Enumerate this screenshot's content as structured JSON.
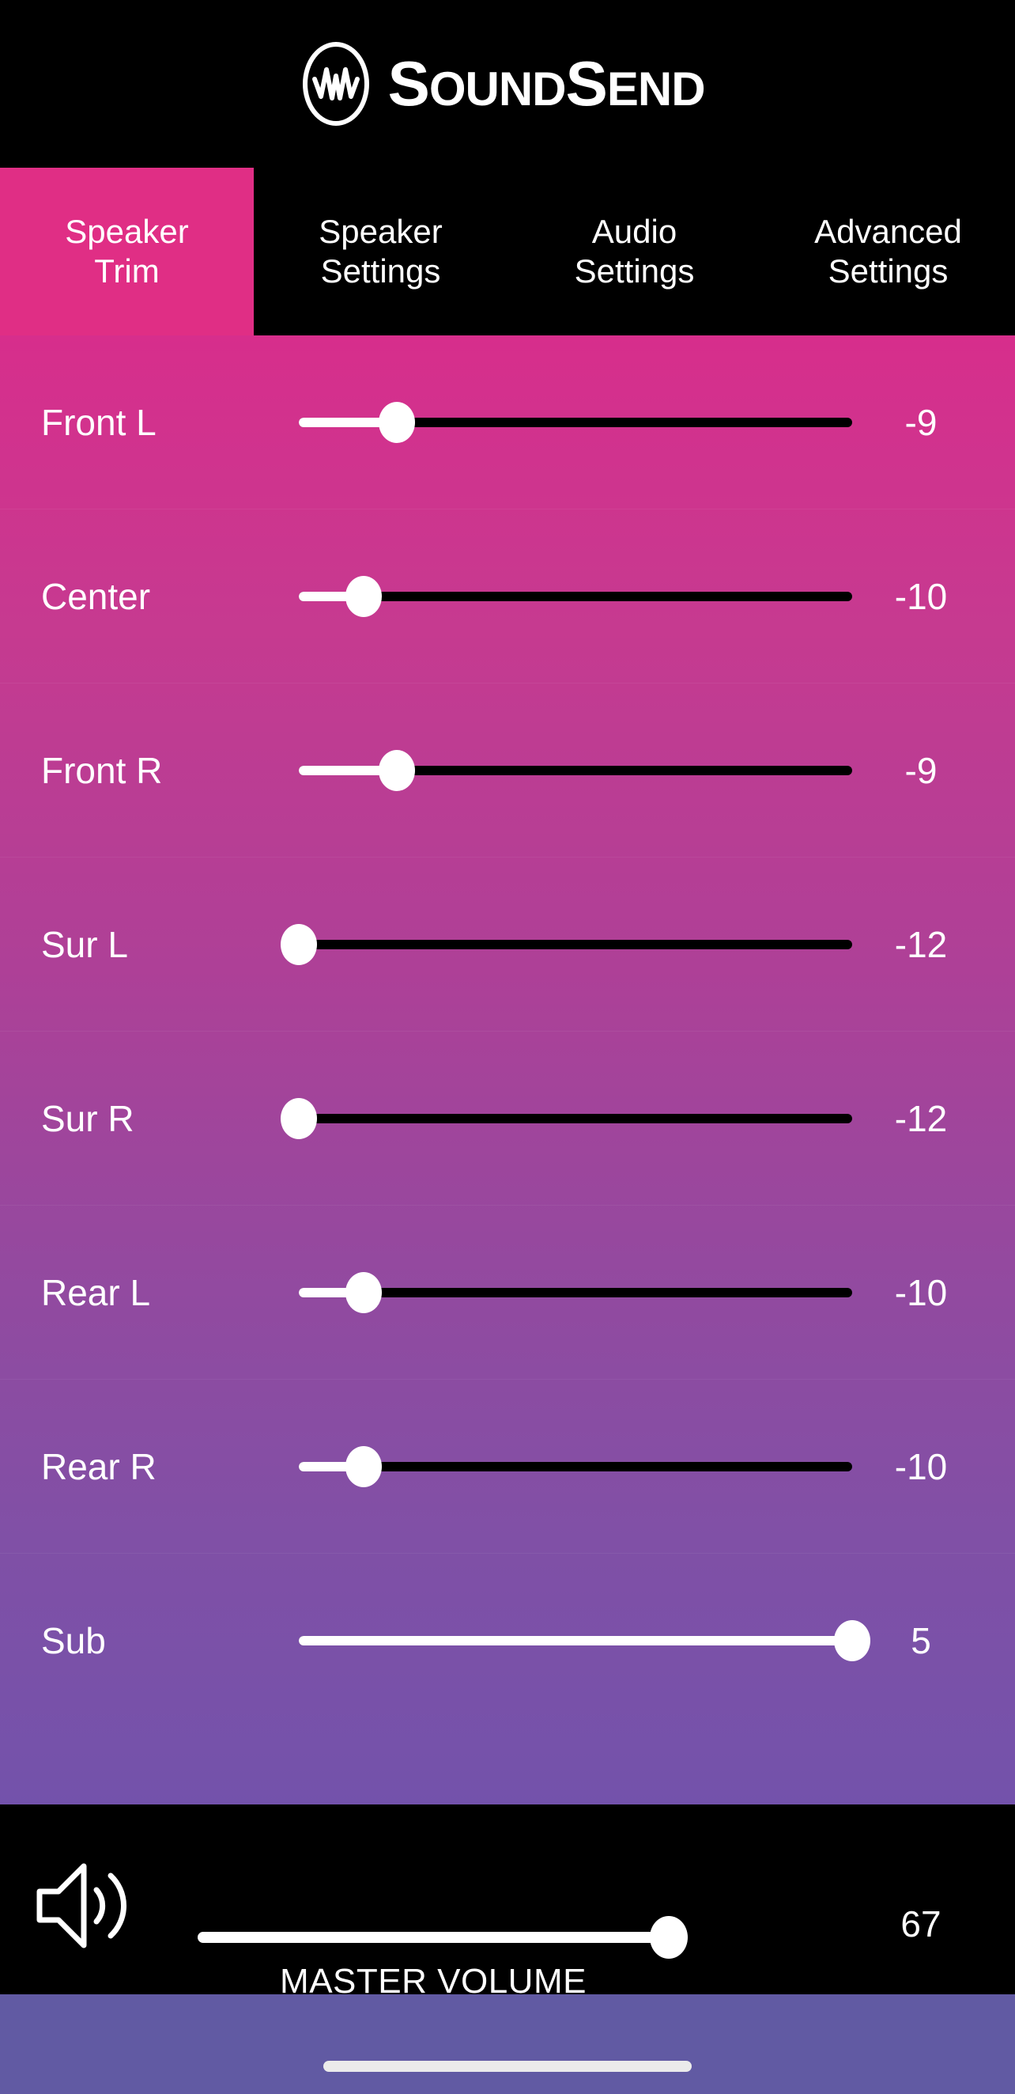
{
  "brand": {
    "name": "SoundSend",
    "name_main": "S",
    "name_rest_1": "OUND",
    "name_cap_2": "S",
    "name_rest_2": "END",
    "logo_icon": "waveform-circle-icon"
  },
  "tabs": [
    {
      "line1": "Speaker",
      "line2": "Trim",
      "active": true
    },
    {
      "line1": "Speaker",
      "line2": "Settings",
      "active": false
    },
    {
      "line1": "Audio",
      "line2": "Settings",
      "active": false
    },
    {
      "line1": "Advanced",
      "line2": "Settings",
      "active": false
    }
  ],
  "trim": {
    "min": -12,
    "max": 5,
    "rows": [
      {
        "label": "Front L",
        "value": "-9",
        "num": -9
      },
      {
        "label": "Center",
        "value": "-10",
        "num": -10
      },
      {
        "label": "Front R",
        "value": "-9",
        "num": -9
      },
      {
        "label": "Sur L",
        "value": "-12",
        "num": -12
      },
      {
        "label": "Sur R",
        "value": "-12",
        "num": -12
      },
      {
        "label": "Rear L",
        "value": "-10",
        "num": -10
      },
      {
        "label": "Rear R",
        "value": "-10",
        "num": -10
      },
      {
        "label": "Sub",
        "value": "5",
        "num": 5
      }
    ]
  },
  "master": {
    "icon": "speaker-volume-icon",
    "label": "MASTER VOLUME",
    "value": "67",
    "num": 67,
    "min": 0,
    "max": 67
  },
  "colors": {
    "accent_pink": "#e02e85",
    "gradient_top": "#d72e8c",
    "gradient_bottom": "#7352ab",
    "bar_black": "#000000",
    "home_bar_bg": "#615aa3"
  },
  "home_indicator": "home-indicator"
}
